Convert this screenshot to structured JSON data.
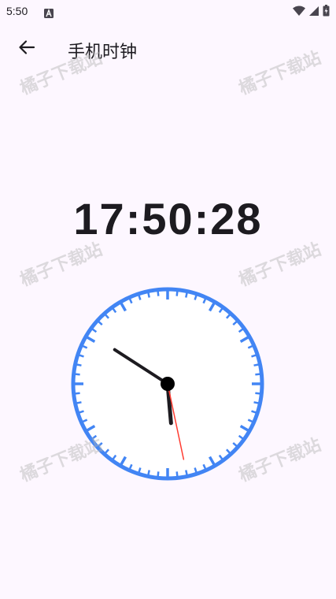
{
  "status_bar": {
    "time": "5:50",
    "notification_icon": "a-badge-icon",
    "icons": [
      "wifi-icon",
      "signal-icon",
      "battery-icon"
    ]
  },
  "app_bar": {
    "back_icon": "arrow-left-icon",
    "title": "手机时钟"
  },
  "digital_clock": {
    "time": "17:50:28"
  },
  "analog_clock": {
    "hours": 17,
    "minutes": 50,
    "seconds": 28,
    "ring_color": "#4285f4",
    "face_color": "#ffffff",
    "hand_color": "#1d1b20",
    "second_hand_color": "#ff3b30"
  },
  "watermark": {
    "text": "橘子下载站"
  },
  "colors": {
    "background": "#fdf7ff",
    "text": "#1d1b20",
    "accent": "#4285f4"
  }
}
